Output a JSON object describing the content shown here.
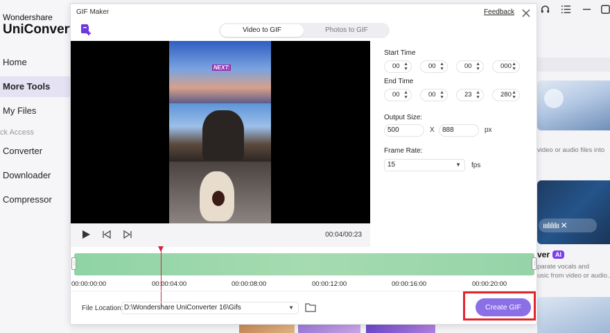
{
  "app": {
    "brand_small": "Wondershare",
    "brand_big": "UniConverter",
    "nav": [
      {
        "label": "Home"
      },
      {
        "label": "More Tools"
      },
      {
        "label": "My Files"
      }
    ],
    "quick_access_label": "ck Access",
    "quick_access_items": [
      {
        "label": "Converter"
      },
      {
        "label": "Downloader"
      },
      {
        "label": "Compressor"
      }
    ],
    "right_panel": {
      "desc1": "video or audio files into",
      "card_title": "ver",
      "ai_badge": "AI",
      "desc2a": "parate vocals and",
      "desc2b": "usic from video or audio..."
    }
  },
  "dialog": {
    "title": "GIF Maker",
    "feedback": "Feedback",
    "tabs": [
      {
        "label": "Video to GIF",
        "active": true
      },
      {
        "label": "Photos to GIF",
        "active": false
      }
    ],
    "preview_text": "NEXT:",
    "timecode": "00:04/00:23",
    "start_time": {
      "label": "Start Time",
      "values": [
        "00",
        "00",
        "00",
        "000"
      ]
    },
    "end_time": {
      "label": "End Time",
      "values": [
        "00",
        "00",
        "23",
        "280"
      ]
    },
    "output_size": {
      "label": "Output Size:",
      "width": "500",
      "x": "X",
      "height": "888",
      "unit": "px"
    },
    "frame_rate": {
      "label": "Frame Rate:",
      "value": "15",
      "unit": "fps"
    },
    "timeline": {
      "ticks": [
        "00:00:00:00",
        "00:00:04:00",
        "00:00:08:00",
        "00:00:12:00",
        "00:00:16:00",
        "00:00:20:00"
      ],
      "playhead_fraction": 0.17
    },
    "file_location": {
      "label": "File Location:",
      "path": "D:\\Wondershare UniConverter 16\\Gifs"
    },
    "create_button": "Create GIF"
  },
  "colors": {
    "accent": "#8b6fe6",
    "highlight": "#e3242b",
    "playhead": "#d2243a",
    "track": "#a6dbb0"
  }
}
